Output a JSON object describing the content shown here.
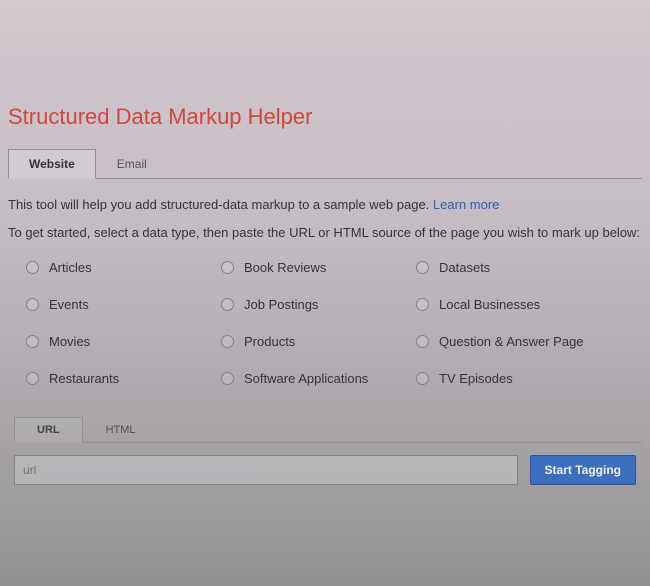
{
  "page": {
    "title": "Structured Data Markup Helper"
  },
  "tabs": {
    "website": "Website",
    "email": "Email"
  },
  "intro": {
    "text": "This tool will help you add structured-data markup to a sample web page. ",
    "learn_more": "Learn more"
  },
  "started": "To get started, select a data type, then paste the URL or HTML source of the page you wish to mark up below:",
  "types": {
    "r0c0": "Articles",
    "r0c1": "Book Reviews",
    "r0c2": "Datasets",
    "r1c0": "Events",
    "r1c1": "Job Postings",
    "r1c2": "Local Businesses",
    "r2c0": "Movies",
    "r2c1": "Products",
    "r2c2": "Question & Answer Page",
    "r3c0": "Restaurants",
    "r3c1": "Software Applications",
    "r3c2": "TV Episodes"
  },
  "subtabs": {
    "url": "URL",
    "html": "HTML"
  },
  "input": {
    "placeholder": "url",
    "value": ""
  },
  "button": {
    "start": "Start Tagging"
  }
}
